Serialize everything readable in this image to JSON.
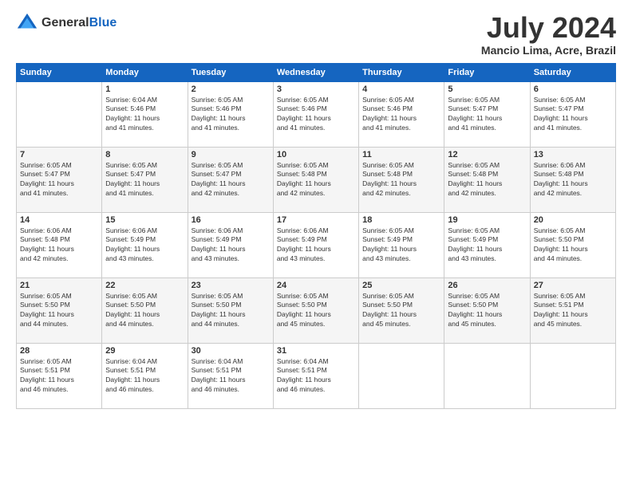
{
  "header": {
    "logo_general": "General",
    "logo_blue": "Blue",
    "title": "July 2024",
    "location": "Mancio Lima, Acre, Brazil"
  },
  "days_of_week": [
    "Sunday",
    "Monday",
    "Tuesday",
    "Wednesday",
    "Thursday",
    "Friday",
    "Saturday"
  ],
  "weeks": [
    [
      {
        "day": "",
        "info": ""
      },
      {
        "day": "1",
        "info": "Sunrise: 6:04 AM\nSunset: 5:46 PM\nDaylight: 11 hours\nand 41 minutes."
      },
      {
        "day": "2",
        "info": "Sunrise: 6:05 AM\nSunset: 5:46 PM\nDaylight: 11 hours\nand 41 minutes."
      },
      {
        "day": "3",
        "info": "Sunrise: 6:05 AM\nSunset: 5:46 PM\nDaylight: 11 hours\nand 41 minutes."
      },
      {
        "day": "4",
        "info": "Sunrise: 6:05 AM\nSunset: 5:46 PM\nDaylight: 11 hours\nand 41 minutes."
      },
      {
        "day": "5",
        "info": "Sunrise: 6:05 AM\nSunset: 5:47 PM\nDaylight: 11 hours\nand 41 minutes."
      },
      {
        "day": "6",
        "info": "Sunrise: 6:05 AM\nSunset: 5:47 PM\nDaylight: 11 hours\nand 41 minutes."
      }
    ],
    [
      {
        "day": "7",
        "info": "Sunrise: 6:05 AM\nSunset: 5:47 PM\nDaylight: 11 hours\nand 41 minutes."
      },
      {
        "day": "8",
        "info": "Sunrise: 6:05 AM\nSunset: 5:47 PM\nDaylight: 11 hours\nand 41 minutes."
      },
      {
        "day": "9",
        "info": "Sunrise: 6:05 AM\nSunset: 5:47 PM\nDaylight: 11 hours\nand 42 minutes."
      },
      {
        "day": "10",
        "info": "Sunrise: 6:05 AM\nSunset: 5:48 PM\nDaylight: 11 hours\nand 42 minutes."
      },
      {
        "day": "11",
        "info": "Sunrise: 6:05 AM\nSunset: 5:48 PM\nDaylight: 11 hours\nand 42 minutes."
      },
      {
        "day": "12",
        "info": "Sunrise: 6:05 AM\nSunset: 5:48 PM\nDaylight: 11 hours\nand 42 minutes."
      },
      {
        "day": "13",
        "info": "Sunrise: 6:06 AM\nSunset: 5:48 PM\nDaylight: 11 hours\nand 42 minutes."
      }
    ],
    [
      {
        "day": "14",
        "info": "Sunrise: 6:06 AM\nSunset: 5:48 PM\nDaylight: 11 hours\nand 42 minutes."
      },
      {
        "day": "15",
        "info": "Sunrise: 6:06 AM\nSunset: 5:49 PM\nDaylight: 11 hours\nand 43 minutes."
      },
      {
        "day": "16",
        "info": "Sunrise: 6:06 AM\nSunset: 5:49 PM\nDaylight: 11 hours\nand 43 minutes."
      },
      {
        "day": "17",
        "info": "Sunrise: 6:06 AM\nSunset: 5:49 PM\nDaylight: 11 hours\nand 43 minutes."
      },
      {
        "day": "18",
        "info": "Sunrise: 6:05 AM\nSunset: 5:49 PM\nDaylight: 11 hours\nand 43 minutes."
      },
      {
        "day": "19",
        "info": "Sunrise: 6:05 AM\nSunset: 5:49 PM\nDaylight: 11 hours\nand 43 minutes."
      },
      {
        "day": "20",
        "info": "Sunrise: 6:05 AM\nSunset: 5:50 PM\nDaylight: 11 hours\nand 44 minutes."
      }
    ],
    [
      {
        "day": "21",
        "info": "Sunrise: 6:05 AM\nSunset: 5:50 PM\nDaylight: 11 hours\nand 44 minutes."
      },
      {
        "day": "22",
        "info": "Sunrise: 6:05 AM\nSunset: 5:50 PM\nDaylight: 11 hours\nand 44 minutes."
      },
      {
        "day": "23",
        "info": "Sunrise: 6:05 AM\nSunset: 5:50 PM\nDaylight: 11 hours\nand 44 minutes."
      },
      {
        "day": "24",
        "info": "Sunrise: 6:05 AM\nSunset: 5:50 PM\nDaylight: 11 hours\nand 45 minutes."
      },
      {
        "day": "25",
        "info": "Sunrise: 6:05 AM\nSunset: 5:50 PM\nDaylight: 11 hours\nand 45 minutes."
      },
      {
        "day": "26",
        "info": "Sunrise: 6:05 AM\nSunset: 5:50 PM\nDaylight: 11 hours\nand 45 minutes."
      },
      {
        "day": "27",
        "info": "Sunrise: 6:05 AM\nSunset: 5:51 PM\nDaylight: 11 hours\nand 45 minutes."
      }
    ],
    [
      {
        "day": "28",
        "info": "Sunrise: 6:05 AM\nSunset: 5:51 PM\nDaylight: 11 hours\nand 46 minutes."
      },
      {
        "day": "29",
        "info": "Sunrise: 6:04 AM\nSunset: 5:51 PM\nDaylight: 11 hours\nand 46 minutes."
      },
      {
        "day": "30",
        "info": "Sunrise: 6:04 AM\nSunset: 5:51 PM\nDaylight: 11 hours\nand 46 minutes."
      },
      {
        "day": "31",
        "info": "Sunrise: 6:04 AM\nSunset: 5:51 PM\nDaylight: 11 hours\nand 46 minutes."
      },
      {
        "day": "",
        "info": ""
      },
      {
        "day": "",
        "info": ""
      },
      {
        "day": "",
        "info": ""
      }
    ]
  ]
}
